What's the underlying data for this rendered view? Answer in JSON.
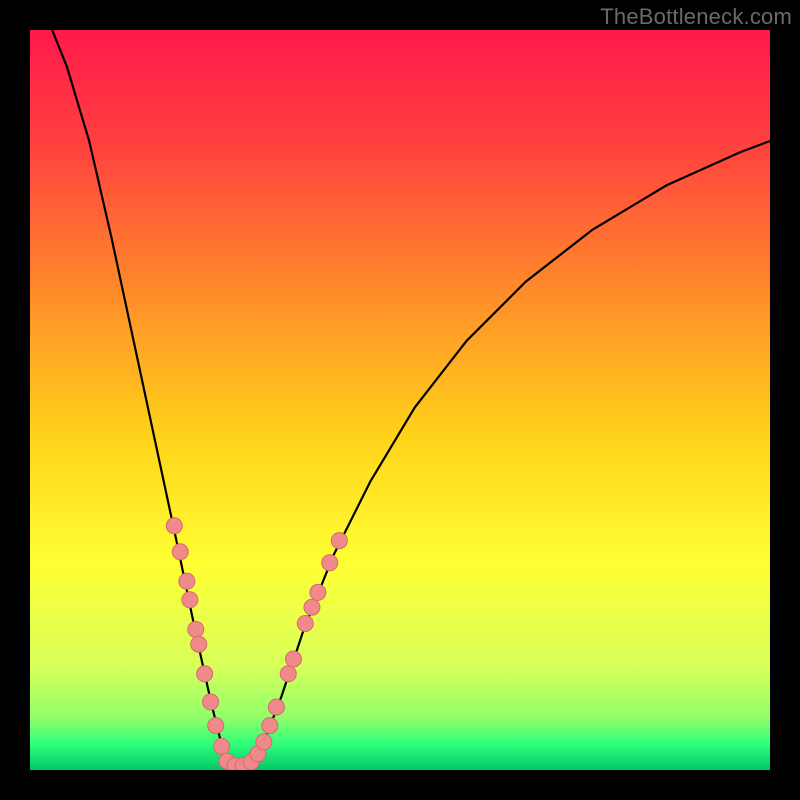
{
  "watermark": "TheBottleneck.com",
  "gradient": {
    "stops": [
      {
        "offset": 0.0,
        "color": "#ff1a4b"
      },
      {
        "offset": 0.15,
        "color": "#ff3f3f"
      },
      {
        "offset": 0.35,
        "color": "#ff8a2a"
      },
      {
        "offset": 0.55,
        "color": "#ffd31a"
      },
      {
        "offset": 0.72,
        "color": "#ffff33"
      },
      {
        "offset": 0.86,
        "color": "#d8ff5a"
      },
      {
        "offset": 0.93,
        "color": "#8fff6a"
      },
      {
        "offset": 0.965,
        "color": "#2fff7a"
      },
      {
        "offset": 1.0,
        "color": "#00c86a"
      }
    ]
  },
  "curve_color": "#000000",
  "dot_fill": "#f08a8a",
  "dot_stroke": "#d46a6a",
  "chart_data": {
    "type": "line",
    "title": "",
    "xlabel": "",
    "ylabel": "",
    "xlim": [
      0,
      100
    ],
    "ylim": [
      0,
      100
    ],
    "notch_x": 28,
    "comment": "Clamped V-shaped bottleneck curve. y is a percentage-like mismatch; notch at x≈28 where y→0.",
    "curve": [
      {
        "x": 3.0,
        "y": 100.0
      },
      {
        "x": 5.0,
        "y": 95.0
      },
      {
        "x": 8.0,
        "y": 85.0
      },
      {
        "x": 11.0,
        "y": 72.0
      },
      {
        "x": 14.0,
        "y": 58.0
      },
      {
        "x": 17.0,
        "y": 44.0
      },
      {
        "x": 20.0,
        "y": 30.0
      },
      {
        "x": 22.5,
        "y": 18.0
      },
      {
        "x": 24.5,
        "y": 9.0
      },
      {
        "x": 26.0,
        "y": 3.0
      },
      {
        "x": 27.2,
        "y": 0.8
      },
      {
        "x": 28.0,
        "y": 0.4
      },
      {
        "x": 29.0,
        "y": 0.4
      },
      {
        "x": 30.0,
        "y": 0.9
      },
      {
        "x": 31.5,
        "y": 3.5
      },
      {
        "x": 34.0,
        "y": 10.0
      },
      {
        "x": 37.0,
        "y": 19.0
      },
      {
        "x": 41.0,
        "y": 29.0
      },
      {
        "x": 46.0,
        "y": 39.0
      },
      {
        "x": 52.0,
        "y": 49.0
      },
      {
        "x": 59.0,
        "y": 58.0
      },
      {
        "x": 67.0,
        "y": 66.0
      },
      {
        "x": 76.0,
        "y": 73.0
      },
      {
        "x": 86.0,
        "y": 79.0
      },
      {
        "x": 96.0,
        "y": 83.5
      },
      {
        "x": 100.0,
        "y": 85.0
      }
    ],
    "dots_left": [
      {
        "x": 19.5,
        "y": 33.0
      },
      {
        "x": 20.3,
        "y": 29.5
      },
      {
        "x": 21.2,
        "y": 25.5
      },
      {
        "x": 21.6,
        "y": 23.0
      },
      {
        "x": 22.4,
        "y": 19.0
      },
      {
        "x": 22.8,
        "y": 17.0
      },
      {
        "x": 23.6,
        "y": 13.0
      },
      {
        "x": 24.4,
        "y": 9.2
      },
      {
        "x": 25.1,
        "y": 6.0
      },
      {
        "x": 25.9,
        "y": 3.2
      }
    ],
    "dots_right": [
      {
        "x": 31.6,
        "y": 3.8
      },
      {
        "x": 32.4,
        "y": 6.0
      },
      {
        "x": 33.3,
        "y": 8.5
      },
      {
        "x": 34.9,
        "y": 13.0
      },
      {
        "x": 35.6,
        "y": 15.0
      },
      {
        "x": 37.2,
        "y": 19.8
      },
      {
        "x": 38.1,
        "y": 22.0
      },
      {
        "x": 38.9,
        "y": 24.0
      },
      {
        "x": 40.5,
        "y": 28.0
      },
      {
        "x": 41.8,
        "y": 31.0
      }
    ],
    "dots_bottom": [
      {
        "x": 26.6,
        "y": 1.2
      },
      {
        "x": 27.7,
        "y": 0.6
      },
      {
        "x": 28.8,
        "y": 0.6
      },
      {
        "x": 29.9,
        "y": 1.1
      },
      {
        "x": 30.8,
        "y": 2.2
      }
    ]
  }
}
